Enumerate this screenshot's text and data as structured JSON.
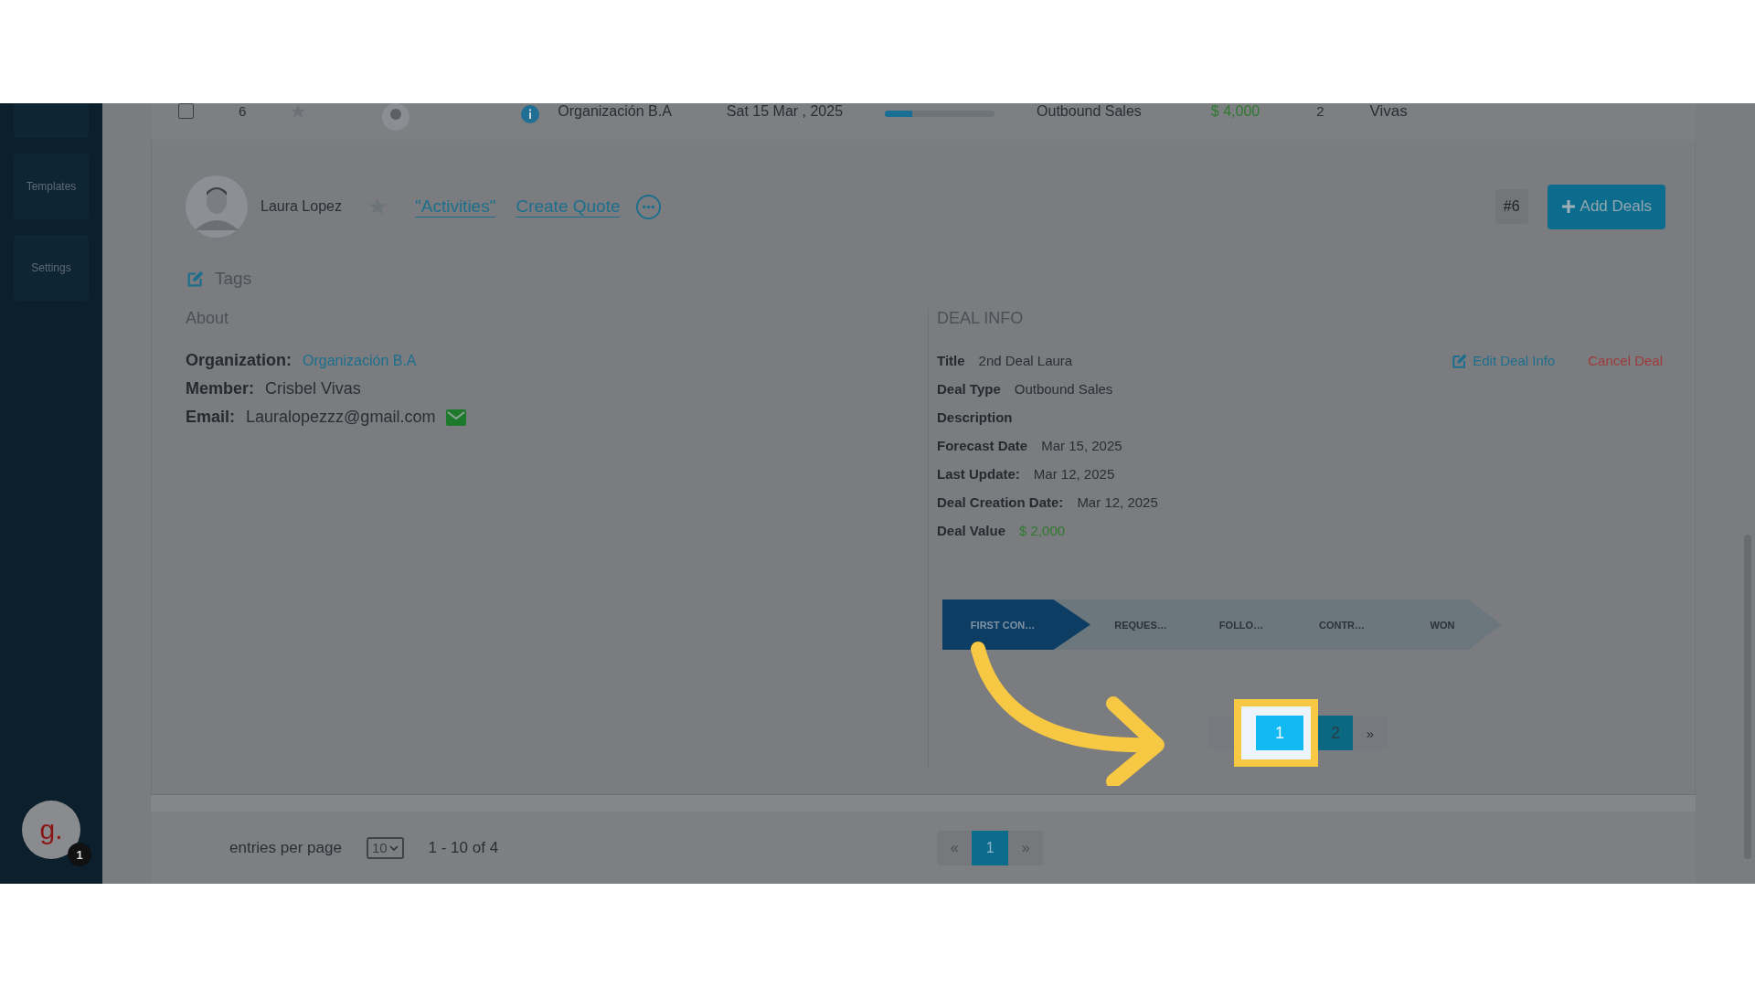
{
  "sidebar": {
    "items": [
      {
        "label": "Templates"
      },
      {
        "label": "Settings"
      }
    ],
    "user": {
      "letter": "g.",
      "badge": "1"
    }
  },
  "top_row": {
    "checked": false,
    "number": "6",
    "organization": "Organización B.A",
    "date": "Sat 15 Mar , 2025",
    "level": 0.25,
    "deal_type": "Outbound Sales",
    "value": "$ 4,000",
    "count": "2",
    "member": "Vivas"
  },
  "contact": {
    "name": "Laura Lopez",
    "starred": false,
    "links": [
      "\"Activities\"",
      "Create Quote"
    ],
    "deal_number": "#6",
    "add_button": "Add Deals",
    "tags_label": "Tags"
  },
  "about": {
    "heading": "About",
    "fields": [
      {
        "label": "Organization:",
        "value": "Organización B.A",
        "kind": "link"
      },
      {
        "label": "Member:",
        "value": "Crisbel Vivas",
        "kind": "text"
      },
      {
        "label": "Email:",
        "value": "Lauralopezzz@gmail.com",
        "kind": "email"
      }
    ]
  },
  "deal_info": {
    "heading": "DEAL INFO",
    "actions": [
      {
        "label": "Edit Deal Info",
        "kind": "edit"
      },
      {
        "label": "Cancel Deal",
        "kind": "cancel"
      }
    ],
    "fields": [
      {
        "label": "Title",
        "value": "2nd Deal Laura",
        "kind": "text"
      },
      {
        "label": "Deal Type",
        "value": "Outbound Sales",
        "kind": "text"
      },
      {
        "label": "Description"
      },
      {
        "label": "Forecast Date",
        "value": "Mar 15, 2025",
        "kind": "text"
      },
      {
        "label": "Last Update:",
        "value": "Mar 12, 2025",
        "kind": "text"
      },
      {
        "label": "Deal Creation Date:",
        "value": "Mar 12, 2025",
        "kind": "text"
      },
      {
        "label": "Deal Value",
        "value": "$ 2,000",
        "kind": "money"
      }
    ]
  },
  "pipeline": {
    "stages": [
      {
        "label": "FIRST CON…",
        "selected": true
      },
      {
        "label": "REQUES…",
        "selected": false
      },
      {
        "label": "FOLLO…",
        "selected": false
      },
      {
        "label": "CONTR…",
        "selected": false
      },
      {
        "label": "WON",
        "selected": false
      }
    ]
  },
  "deal_pagination": {
    "pages": [
      {
        "label": "1",
        "selected": true
      },
      {
        "label": "2",
        "selected": false
      }
    ],
    "next": "»"
  },
  "footer": {
    "entries_label": "entries per page",
    "page_size": "10",
    "range": "1 - 10 of 4",
    "prev": "«",
    "pages": [
      {
        "label": "1",
        "selected": true
      }
    ],
    "next": "»"
  }
}
